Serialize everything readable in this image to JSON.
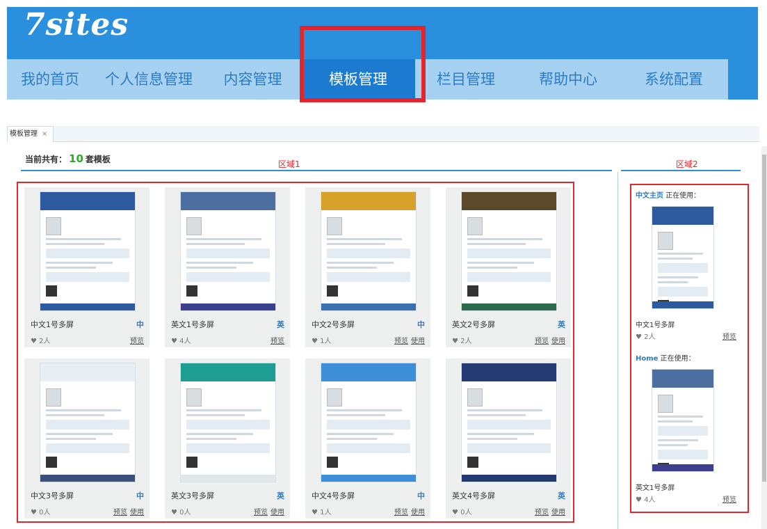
{
  "app": {
    "logo": "7sites"
  },
  "nav": {
    "items": [
      "我的首页",
      "个人信息管理",
      "内容管理",
      "模板管理",
      "栏目管理",
      "帮助中心",
      "系统配置"
    ],
    "active_index": 3
  },
  "tab": {
    "label": "模板管理",
    "close": "×"
  },
  "summary": {
    "prefix": "当前共有：",
    "count": "10",
    "suffix": "套模板"
  },
  "zones": {
    "area1": "区域1",
    "area2": "区域2"
  },
  "templates": [
    {
      "name": "中文1号多屏",
      "lang": "中",
      "likes": "2人",
      "links": [
        "预览"
      ],
      "banner": "#2d5a9e",
      "footer": "#2d5a9e"
    },
    {
      "name": "英文1号多屏",
      "lang": "英",
      "likes": "4人",
      "links": [
        "预览"
      ],
      "banner": "#4a6fa0",
      "footer": "#3b3f8e"
    },
    {
      "name": "中文2号多屏",
      "lang": "中",
      "likes": "1人",
      "links": [
        "预览",
        "使用"
      ],
      "banner": "#d6a128",
      "footer": "#3a6fb0"
    },
    {
      "name": "英文2号多屏",
      "lang": "英",
      "likes": "2人",
      "links": [
        "预览",
        "使用"
      ],
      "banner": "#5b4a2a",
      "footer": "#2d6a4a"
    },
    {
      "name": "中文3号多屏",
      "lang": "中",
      "likes": "0人",
      "links": [
        "预览",
        "使用"
      ],
      "banner": "#e8eef4",
      "footer": "#3a4f7a"
    },
    {
      "name": "英文3号多屏",
      "lang": "英",
      "likes": "0人",
      "links": [
        "预览",
        "使用"
      ],
      "banner": "#1e9e93",
      "footer": "#e0e8ea"
    },
    {
      "name": "中文4号多屏",
      "lang": "中",
      "likes": "1人",
      "links": [
        "预览",
        "使用"
      ],
      "banner": "#3d8fd8",
      "footer": "#3d8fd8"
    },
    {
      "name": "英文4号多屏",
      "lang": "英",
      "likes": "0人",
      "links": [
        "预览",
        "使用"
      ],
      "banner": "#233a72",
      "footer": "#233a72"
    }
  ],
  "in_use": [
    {
      "label": "中文主页",
      "status": "正在使用：",
      "name": "中文1号多屏",
      "likes": "2人",
      "link": "预览",
      "banner": "#2d5a9e"
    },
    {
      "label": "Home",
      "status": "正在使用：",
      "name": "英文1号多屏",
      "likes": "4人",
      "link": "预览",
      "banner": "#4a6fa0"
    }
  ],
  "colors": {
    "header": "#2a8fdc",
    "nav_bg": "#a7d1f0",
    "active": "#1c7bd0",
    "highlight": "#e2262c"
  }
}
